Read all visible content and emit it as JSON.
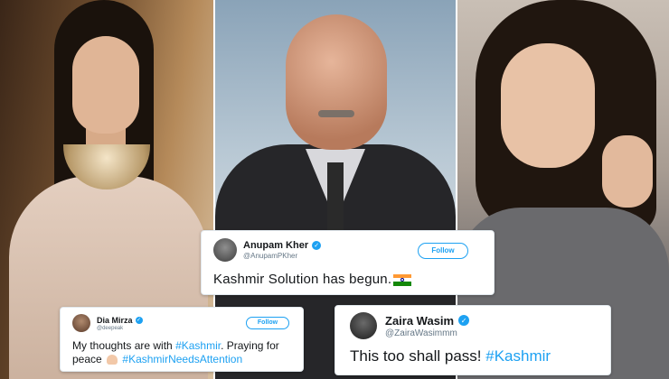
{
  "tweets": {
    "anupam": {
      "name": "Anupam Kher",
      "handle": "@AnupamPKher",
      "follow": "Follow",
      "text": "Kashmir Solution has begun."
    },
    "dia": {
      "name": "Dia Mirza",
      "handle": "@deepeak",
      "follow": "Follow",
      "text_before": "My thoughts are with ",
      "hashtag1": "#Kashmir",
      "text_mid": ". Praying for peace",
      "hashtag2": "#KashmirNeedsAttention"
    },
    "zaira": {
      "name": "Zaira Wasim",
      "handle": "@ZairaWasimmm",
      "text_before": "This too shall pass! ",
      "hashtag": "#Kashmir"
    }
  },
  "icons": {
    "verified": "verified-badge-icon",
    "flag": "india-flag-icon",
    "pray": "folded-hands-icon"
  },
  "colors": {
    "twitter_blue": "#1da1f2",
    "handle_gray": "#657786",
    "flag_saffron": "#ff9933",
    "flag_green": "#138808"
  }
}
